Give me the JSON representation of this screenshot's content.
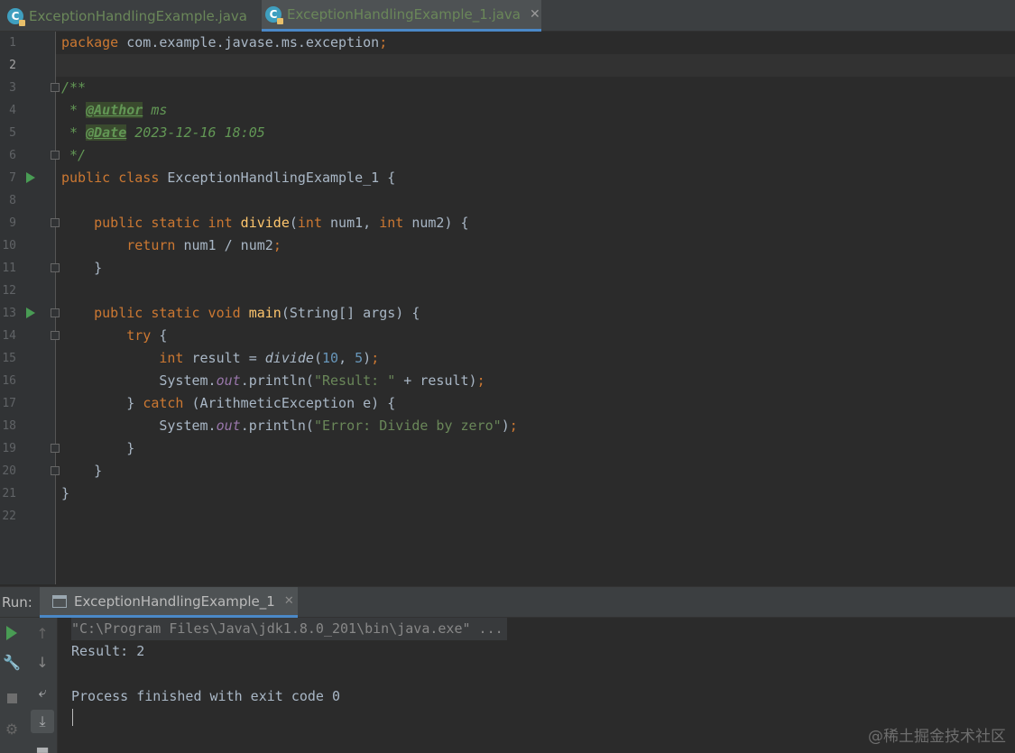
{
  "tabs": [
    {
      "label": "ExceptionHandlingExample.java",
      "icon": "java-class-icon",
      "active": false
    },
    {
      "label": "ExceptionHandlingExample_1.java",
      "icon": "java-class-icon",
      "active": true
    }
  ],
  "editor": {
    "line_numbers": [
      "1",
      "2",
      "3",
      "4",
      "5",
      "6",
      "7",
      "8",
      "9",
      "10",
      "11",
      "12",
      "13",
      "14",
      "15",
      "16",
      "17",
      "18",
      "19",
      "20",
      "21",
      "22"
    ],
    "current_line": 2,
    "code": {
      "l1_kw": "package",
      "l1_rest": " com.example.javase.ms.exception",
      "l1_semi": ";",
      "l3": "/**",
      "l4_star": " * ",
      "l4_tag": "@Author",
      "l4_val": " ms",
      "l5_star": " * ",
      "l5_tag": "@Date",
      "l5_val": " 2023-12-16 18:05",
      "l6": " */",
      "l7_kw": "public class",
      "l7_rest": " ExceptionHandlingExample_1 {",
      "l9_kw1": "    public static int",
      "l9_fn": " divide",
      "l9_p1": "(",
      "l9_kw2": "int",
      "l9_p2": " num1, ",
      "l9_kw3": "int",
      "l9_p3": " num2) {",
      "l10_kw": "        return",
      "l10_rest": " num1 / num2",
      "l10_semi": ";",
      "l11": "    }",
      "l13_kw": "    public static void",
      "l13_fn": " main",
      "l13_rest": "(String[] args) {",
      "l14_kw": "        try",
      "l14_rest": " {",
      "l15_kw": "            int",
      "l15_a": " result = ",
      "l15_fn": "divide",
      "l15_b": "(",
      "l15_n1": "10",
      "l15_c": ", ",
      "l15_n2": "5",
      "l15_d": ")",
      "l15_semi": ";",
      "l16_a": "            System.",
      "l16_field": "out",
      "l16_b": ".println(",
      "l16_str": "\"Result: \"",
      "l16_c": " + result)",
      "l16_semi": ";",
      "l17_a": "        } ",
      "l17_kw": "catch",
      "l17_b": " (ArithmeticException e) {",
      "l18_a": "            System.",
      "l18_field": "out",
      "l18_b": ".println(",
      "l18_str": "\"Error: Divide by zero\"",
      "l18_c": ")",
      "l18_semi": ";",
      "l19": "        }",
      "l20": "    }",
      "l21": "}"
    }
  },
  "run_panel": {
    "label": "Run:",
    "tab_label": "ExceptionHandlingExample_1",
    "output": [
      "\"C:\\Program Files\\Java\\jdk1.8.0_201\\bin\\java.exe\" ...",
      "Result: 2",
      "",
      "Process finished with exit code 0"
    ]
  },
  "watermark": "@稀土掘金技术社区",
  "colors": {
    "background": "#2b2b2b",
    "keyword": "#cc7832",
    "method": "#ffc66d",
    "string": "#6a8759",
    "number": "#6897bb",
    "accent": "#4a88c7"
  }
}
